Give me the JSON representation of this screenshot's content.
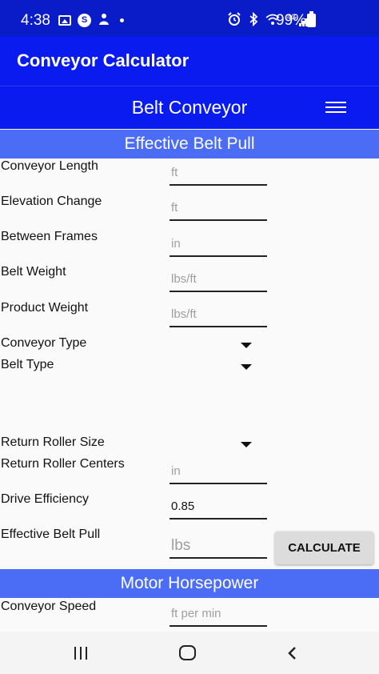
{
  "status_bar": {
    "time": "4:38",
    "left_icons": [
      "image-icon",
      "s-circle-icon",
      "person-icon",
      "dot-icon"
    ],
    "right_icons": [
      "alarm-icon",
      "bluetooth-icon",
      "wifi-icon",
      "signal-icon"
    ],
    "network_label": "4G",
    "battery_text": "99%"
  },
  "app_bar": {
    "title": "Conveyor Calculator"
  },
  "sub_bar": {
    "title": "Belt Conveyor",
    "menu_icon": "hamburger-menu-icon"
  },
  "sections": {
    "effective_belt_pull": "Effective Belt Pull",
    "motor_horsepower": "Motor Horsepower"
  },
  "fields": {
    "conveyor_length": {
      "label": "Conveyor Length",
      "placeholder": "ft"
    },
    "elevation_change": {
      "label": "Elevation Change",
      "placeholder": "ft"
    },
    "between_frames": {
      "label": "Between Frames",
      "placeholder": "in"
    },
    "belt_weight": {
      "label": "Belt Weight",
      "placeholder": "lbs/ft"
    },
    "product_weight": {
      "label": "Product Weight",
      "placeholder": "lbs/ft"
    },
    "conveyor_type": {
      "label": "Conveyor Type"
    },
    "belt_type": {
      "label": "Belt Type"
    },
    "return_roller_size": {
      "label": "Return Roller Size"
    },
    "return_roller_centers": {
      "label": "Return Roller Centers",
      "placeholder": "in"
    },
    "drive_efficiency": {
      "label": "Drive Efficiency",
      "value": "0.85"
    },
    "effective_belt_pull": {
      "label": "Effective Belt Pull",
      "placeholder": "lbs"
    },
    "conveyor_speed": {
      "label": "Conveyor Speed",
      "placeholder": "ft per min"
    }
  },
  "buttons": {
    "calculate": "CALCULATE"
  },
  "nav_bar": {
    "recent": "recent-apps-icon",
    "home": "home-icon",
    "back": "back-icon"
  },
  "colors": {
    "status_bar": "#0a1bc8",
    "app_bar": "#0a1bf0",
    "section_header": "#4b6cf5",
    "background": "#fafafa"
  }
}
